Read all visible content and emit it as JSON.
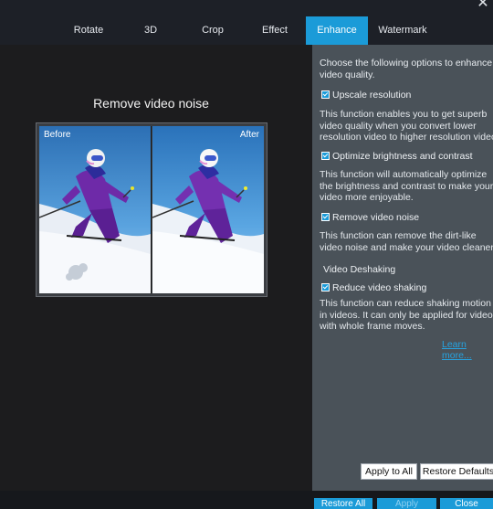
{
  "window": {
    "close_glyph": "✕"
  },
  "tabs": [
    {
      "label": "Rotate",
      "active": false
    },
    {
      "label": "3D",
      "active": false
    },
    {
      "label": "Crop",
      "active": false
    },
    {
      "label": "Effect",
      "active": false
    },
    {
      "label": "Enhance",
      "active": true
    },
    {
      "label": "Watermark",
      "active": false
    }
  ],
  "preview": {
    "title": "Remove video noise",
    "before_label": "Before",
    "after_label": "After"
  },
  "enhance": {
    "intro": "Choose the following options to enhance video quality.",
    "options": [
      {
        "label": "Upscale resolution",
        "checked": true,
        "description": [
          "This function enables you to get superb",
          "video quality when you convert lower",
          "resolution video to higher resolution video."
        ]
      },
      {
        "label": "Optimize brightness and contrast",
        "checked": true,
        "description": [
          "This function will automatically optimize",
          "the brightness and contrast to make your",
          "video more enjoyable."
        ]
      },
      {
        "label": "Remove video noise",
        "checked": true,
        "description": [
          "This function can remove the dirt-like",
          "video noise and make your video cleaner."
        ]
      }
    ],
    "deshake_section": "Video Deshaking",
    "deshake_option": {
      "label": "Reduce video shaking",
      "checked": true,
      "description": [
        "This function can reduce shaking motion",
        "in videos. It can only be applied for videos",
        "with whole frame moves."
      ]
    },
    "learn_more": "Learn more...",
    "apply_to_all": "Apply to All",
    "restore_defaults": "Restore Defaults"
  },
  "footer": {
    "restore_all": "Restore All",
    "apply": "Apply",
    "close": "Close"
  },
  "colors": {
    "accent": "#1b9bd8",
    "panel_bg": "#4a5259",
    "tabbar_bg": "#1d2027"
  }
}
